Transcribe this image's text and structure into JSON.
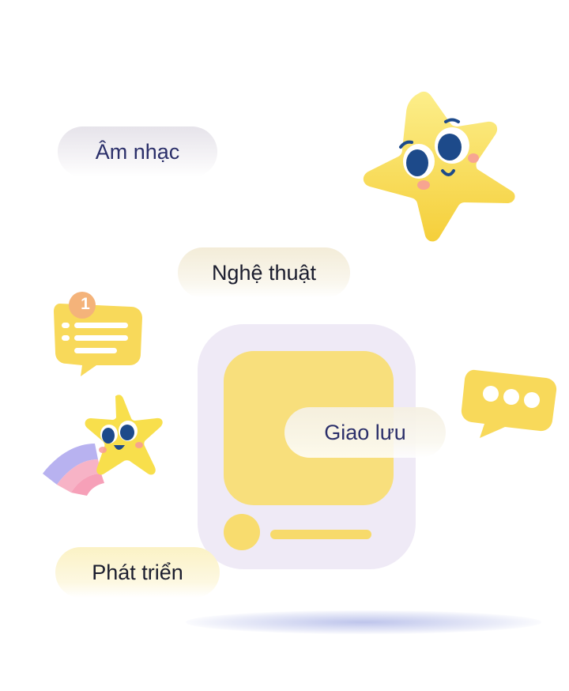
{
  "tags": {
    "music": "Âm nhạc",
    "art": "Nghệ thuật",
    "social": "Giao lưu",
    "development": "Phát triển"
  },
  "notification": {
    "count": "1"
  },
  "icons": {
    "big_star": "smiling-star-icon",
    "small_star": "shooting-star-icon",
    "notification_chat": "chat-bubble-notification-icon",
    "typing_chat": "chat-bubble-typing-icon"
  },
  "colors": {
    "star_yellow": "#f9e15a",
    "card_yellow": "#f8df7c",
    "device_bg": "#efeaf6",
    "text_dark": "#1b1d2e",
    "text_navy": "#2b2f6a"
  }
}
